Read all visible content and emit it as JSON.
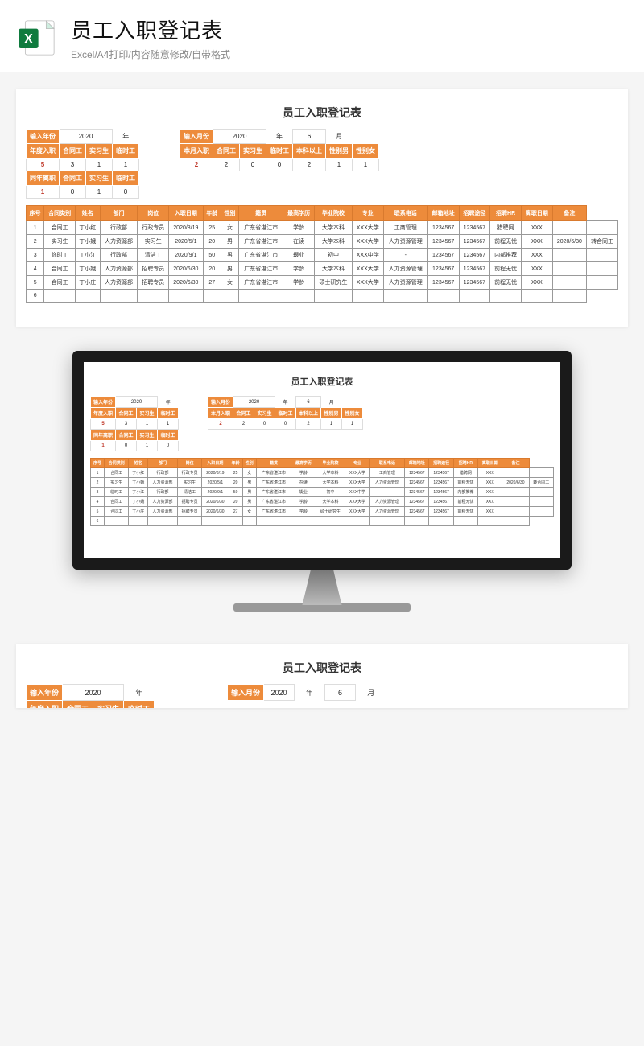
{
  "header": {
    "title": "员工入职登记表",
    "subtitle": "Excel/A4打印/内容随意修改/自带格式",
    "icon_name": "excel-icon"
  },
  "doc": {
    "title": "员工入职登记表",
    "year_block": {
      "input_year_label": "输入年份",
      "year_value": "2020",
      "year_unit": "年",
      "row1": {
        "h1": "年度入职",
        "h2": "合同工",
        "h3": "实习生",
        "h4": "临时工"
      },
      "row1_vals": {
        "v1": "5",
        "v2": "3",
        "v3": "1",
        "v4": "1"
      },
      "row2": {
        "h1": "同年离职",
        "h2": "合同工",
        "h3": "实习生",
        "h4": "临时工"
      },
      "row2_vals": {
        "v1": "1",
        "v2": "0",
        "v3": "1",
        "v4": "0"
      }
    },
    "month_block": {
      "input_month_label": "输入月份",
      "year_value": "2020",
      "year_unit": "年",
      "month_value": "6",
      "month_unit": "月",
      "row1": {
        "h1": "本月入职",
        "h2": "合同工",
        "h3": "实习生",
        "h4": "临时工",
        "h5": "本科以上",
        "h6": "性别男",
        "h7": "性别女"
      },
      "row1_vals": {
        "v1": "2",
        "v2": "2",
        "v3": "0",
        "v4": "0",
        "v5": "2",
        "v6": "1",
        "v7": "1"
      }
    },
    "columns": [
      "序号",
      "合同类别",
      "姓名",
      "部门",
      "岗位",
      "入职日期",
      "年龄",
      "性别",
      "籍贯",
      "最高学历",
      "毕业院校",
      "专业",
      "联系电话",
      "邮箱地址",
      "招聘途径",
      "招聘HR",
      "离职日期",
      "备注"
    ],
    "rows": [
      [
        "1",
        "合同工",
        "丁小红",
        "行政部",
        "行政专员",
        "2020/8/19",
        "25",
        "女",
        "广东省湛江市",
        "学龄",
        "大学本科",
        "XXX大学",
        "工商管理",
        "1234567",
        "1234567",
        "猎聘网",
        "XXX",
        "",
        ""
      ],
      [
        "2",
        "实习生",
        "丁小娥",
        "人力资源部",
        "实习生",
        "2020/5/1",
        "20",
        "男",
        "广东省湛江市",
        "在读",
        "大学本科",
        "XXX大学",
        "人力资源管理",
        "1234567",
        "1234567",
        "前程无忧",
        "XXX",
        "2020/6/30",
        "转合同工"
      ],
      [
        "3",
        "临时工",
        "丁小江",
        "行政部",
        "清洁工",
        "2020/9/1",
        "50",
        "男",
        "广东省湛江市",
        "辍业",
        "初中",
        "XXX中学",
        "-",
        "1234567",
        "1234567",
        "内部推荐",
        "XXX",
        "",
        ""
      ],
      [
        "4",
        "合同工",
        "丁小娥",
        "人力资源部",
        "招聘专员",
        "2020/6/30",
        "20",
        "男",
        "广东省湛江市",
        "学龄",
        "大学本科",
        "XXX大学",
        "人力资源管理",
        "1234567",
        "1234567",
        "前程无忧",
        "XXX",
        "",
        ""
      ],
      [
        "5",
        "合同工",
        "丁小庄",
        "人力资源部",
        "招聘专员",
        "2020/6/30",
        "27",
        "女",
        "广东省湛江市",
        "学龄",
        "硕士研究生",
        "XXX大学",
        "人力资源管理",
        "1234567",
        "1234567",
        "前程无忧",
        "XXX",
        "",
        ""
      ],
      [
        "6",
        "",
        "",
        "",
        "",
        "",
        "",
        "",
        "",
        "",
        "",
        "",
        "",
        "",
        "",
        "",
        "",
        ""
      ]
    ]
  }
}
